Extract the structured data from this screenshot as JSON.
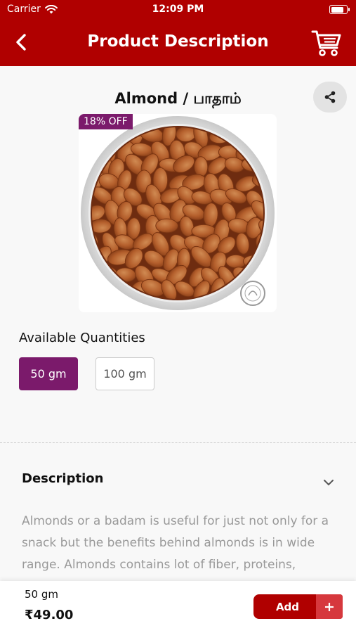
{
  "status_bar": {
    "carrier": "Carrier",
    "time": "12:09 PM",
    "battery_level": 0.85
  },
  "nav": {
    "title": "Product Description"
  },
  "product": {
    "title": "Almond / பாதாம்",
    "discount": "18% OFF"
  },
  "quantities": {
    "heading": "Available Quantities",
    "options": [
      "50 gm",
      "100 gm"
    ],
    "selected": "50 gm"
  },
  "description": {
    "heading": "Description",
    "text": "Almonds or a badam is useful for just not only for a snack but the benefits behind almonds is in wide range. Almonds contains lot of fiber, proteins,"
  },
  "bottom_bar": {
    "quantity": "50 gm",
    "price": "₹49.00",
    "add_label": "Add"
  },
  "colors": {
    "primary": "#b00000",
    "accent": "#7b1a6b",
    "add_plus": "#d6383d"
  }
}
